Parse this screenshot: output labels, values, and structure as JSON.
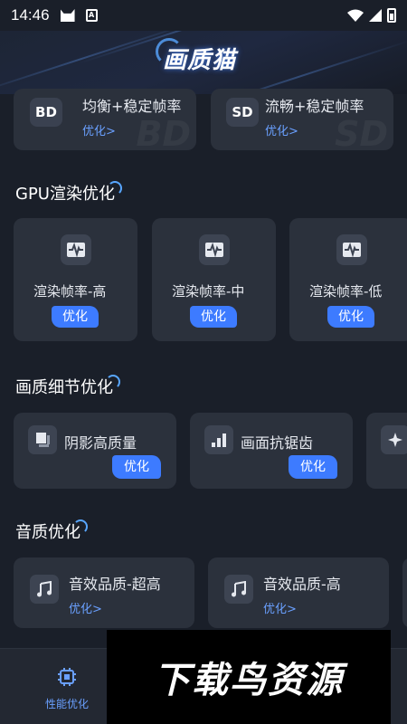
{
  "status_bar": {
    "time": "14:46",
    "a_icon": "A"
  },
  "header": {
    "title": "画质猫"
  },
  "top_cards": [
    {
      "badge": "BD",
      "title": "均衡+稳定帧率",
      "action": "优化>",
      "watermark": "BD"
    },
    {
      "badge": "SD",
      "title": "流畅+稳定帧率",
      "action": "优化>",
      "watermark": "SD"
    }
  ],
  "gpu_section": {
    "title": "GPU渲染优化",
    "cards": [
      {
        "label": "渲染帧率-高",
        "button": "优化",
        "icon": "waveform-icon"
      },
      {
        "label": "渲染帧率-中",
        "button": "优化",
        "icon": "waveform-icon"
      },
      {
        "label": "渲染帧率-低",
        "button": "优化",
        "icon": "waveform-icon"
      }
    ]
  },
  "detail_section": {
    "title": "画质细节优化",
    "cards": [
      {
        "label": "阴影高质量",
        "button": "优化",
        "icon": "shadow-icon"
      },
      {
        "label": "画面抗锯齿",
        "button": "优化",
        "icon": "bars-icon"
      }
    ]
  },
  "audio_section": {
    "title": "音质优化",
    "cards": [
      {
        "label": "音效品质-超高",
        "action": "优化>",
        "icon": "music-note-icon"
      },
      {
        "label": "音效品质-高",
        "action": "优化>",
        "icon": "music-note-icon"
      }
    ]
  },
  "bottom_nav": {
    "items": [
      {
        "label": "性能优化",
        "icon": "chip-icon",
        "active": true
      }
    ]
  },
  "ad_banner": {
    "text": "下载鸟资源"
  },
  "colors": {
    "accent": "#3d7bff",
    "link": "#6aa0ff",
    "card": "#2b313c",
    "background": "#1a1f29"
  }
}
